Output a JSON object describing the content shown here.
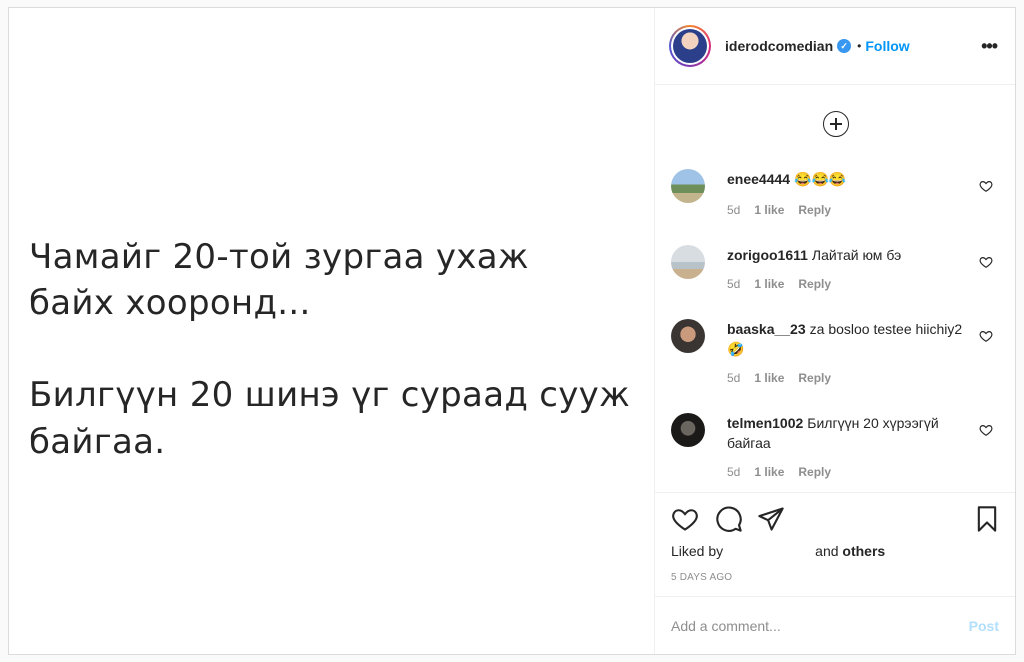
{
  "media": {
    "line1": "Чамайг 20-той зургаа ухаж",
    "line2": "байх хооронд...",
    "line3": "Билгүүн 20 шинэ үг сураад сууж",
    "line4": "байгаа."
  },
  "header": {
    "username": "iderodcomedian",
    "verified_mark": "✓",
    "dot": "•",
    "follow_label": "Follow",
    "more_label": "•••"
  },
  "comments": [
    {
      "user": "enee4444",
      "text": "😂😂😂",
      "age": "5d",
      "likes": "1 like",
      "reply": "Reply"
    },
    {
      "user": "zorigoo1611",
      "text": "Лайтай юм бэ",
      "age": "5d",
      "likes": "1 like",
      "reply": "Reply"
    },
    {
      "user": "baaska__23",
      "text": "za bosloo testee hiichiy2🤣",
      "age": "5d",
      "likes": "1 like",
      "reply": "Reply"
    },
    {
      "user": "telmen1002",
      "text": "Билгүүн 20 хүрээгүй байгаа",
      "age": "5d",
      "likes": "1 like",
      "reply": "Reply"
    }
  ],
  "actions": {
    "liked_by_prefix": "Liked by",
    "and_text": "and",
    "others": "others",
    "time_ago": "5 DAYS AGO"
  },
  "add_comment": {
    "placeholder": "Add a comment...",
    "post_label": "Post"
  },
  "icons": {
    "like": "heart-icon",
    "comment": "comment-icon",
    "share": "paper-plane-icon",
    "save": "bookmark-icon",
    "load_more": "plus-circle-icon",
    "more": "ellipsis-icon"
  },
  "colors": {
    "link_blue": "#0095f6",
    "verified_blue": "#3897f0",
    "post_disabled": "#b2dffc",
    "secondary_text": "#8e8e8e"
  }
}
